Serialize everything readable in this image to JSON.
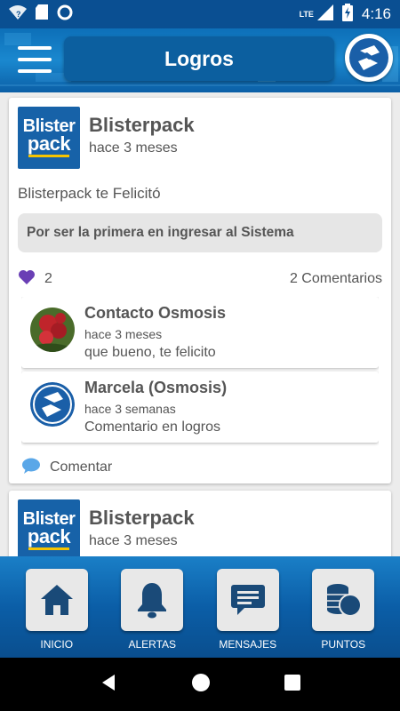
{
  "status_bar": {
    "time": "4:16",
    "network": "LTE",
    "wifi_badge": "?"
  },
  "header": {
    "title": "Logros",
    "menu_icon": "hamburger-menu-icon",
    "logo_icon": "osmosis-logo-icon"
  },
  "posts": [
    {
      "brand_line1": "Blister",
      "brand_line2": "pack",
      "author": "Blisterpack",
      "time_ago": "hace 3 meses",
      "text": "Blisterpack te Felicitó",
      "reason": "Por ser la primera en ingresar al Sistema",
      "likes": "2",
      "comments_count": "2 Comentarios",
      "comments": [
        {
          "name": "Contacto Osmosis",
          "time": "hace 3 meses",
          "text": "que bueno, te felicito"
        },
        {
          "name": "Marcela (Osmosis)",
          "time": "hace 3 semanas",
          "text": "Comentario en logros"
        }
      ],
      "comment_action": "Comentar"
    },
    {
      "brand_line1": "Blister",
      "brand_line2": "pack",
      "author": "Blisterpack",
      "time_ago": "hace 3 meses"
    }
  ],
  "bottom_nav": [
    {
      "label": "INICIO",
      "icon": "home-icon"
    },
    {
      "label": "ALERTAS",
      "icon": "bell-icon"
    },
    {
      "label": "MENSAJES",
      "icon": "message-icon"
    },
    {
      "label": "PUNTOS",
      "icon": "coins-icon"
    }
  ],
  "colors": {
    "primary_blue": "#0a4f92",
    "accent_purple": "#6a3fb5",
    "chat_blue": "#5aa7e8",
    "text_gray": "#555555"
  }
}
